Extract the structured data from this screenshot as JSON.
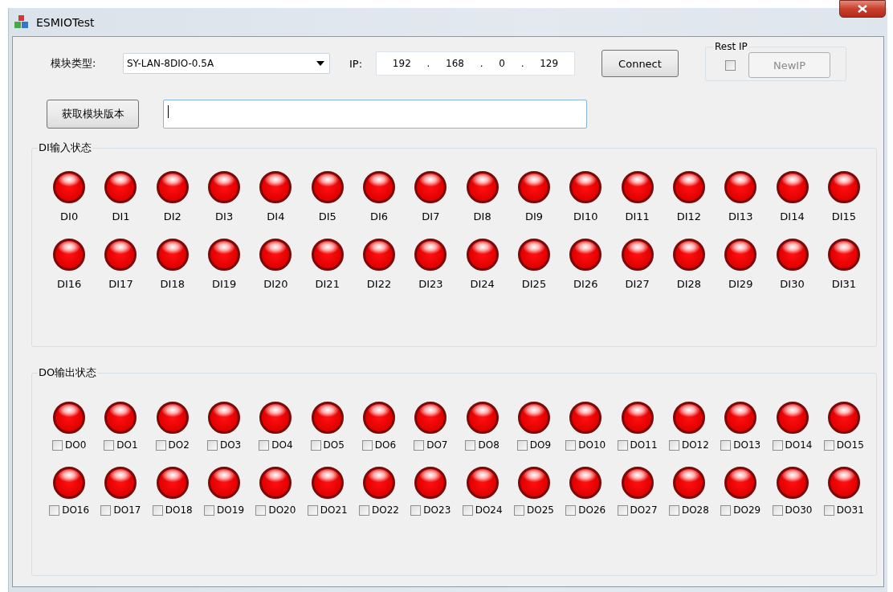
{
  "window": {
    "title": "ESMIOTest"
  },
  "module_type": {
    "label": "模块类型:",
    "value": "SY-LAN-8DIO-0.5A"
  },
  "ip": {
    "label": "IP:",
    "octets": [
      "192",
      "168",
      "0",
      "129"
    ],
    "separator": "."
  },
  "connect_button": "Connect",
  "reset_ip": {
    "title": "Rest IP",
    "checked": false,
    "button": {
      "label": "NewIP",
      "disabled": true
    }
  },
  "version_button": "获取模块版本",
  "di_group": {
    "title": "DI输入状态",
    "inputs": [
      {
        "label": "DI0",
        "on": true
      },
      {
        "label": "DI1",
        "on": true
      },
      {
        "label": "DI2",
        "on": true
      },
      {
        "label": "DI3",
        "on": true
      },
      {
        "label": "DI4",
        "on": true
      },
      {
        "label": "DI5",
        "on": true
      },
      {
        "label": "DI6",
        "on": true
      },
      {
        "label": "DI7",
        "on": true
      },
      {
        "label": "DI8",
        "on": true
      },
      {
        "label": "DI9",
        "on": true
      },
      {
        "label": "DI10",
        "on": true
      },
      {
        "label": "DI11",
        "on": true
      },
      {
        "label": "DI12",
        "on": true
      },
      {
        "label": "DI13",
        "on": true
      },
      {
        "label": "DI14",
        "on": true
      },
      {
        "label": "DI15",
        "on": true
      },
      {
        "label": "DI16",
        "on": true
      },
      {
        "label": "DI17",
        "on": true
      },
      {
        "label": "DI18",
        "on": true
      },
      {
        "label": "DI19",
        "on": true
      },
      {
        "label": "DI20",
        "on": true
      },
      {
        "label": "DI21",
        "on": true
      },
      {
        "label": "DI22",
        "on": true
      },
      {
        "label": "DI23",
        "on": true
      },
      {
        "label": "DI24",
        "on": true
      },
      {
        "label": "DI25",
        "on": true
      },
      {
        "label": "DI26",
        "on": true
      },
      {
        "label": "DI27",
        "on": true
      },
      {
        "label": "DI28",
        "on": true
      },
      {
        "label": "DI29",
        "on": true
      },
      {
        "label": "DI30",
        "on": true
      },
      {
        "label": "DI31",
        "on": true
      }
    ]
  },
  "do_group": {
    "title": "DO输出状态",
    "outputs": [
      {
        "label": "DO0",
        "on": true,
        "checked": false
      },
      {
        "label": "DO1",
        "on": true,
        "checked": false
      },
      {
        "label": "DO2",
        "on": true,
        "checked": false
      },
      {
        "label": "DO3",
        "on": true,
        "checked": false
      },
      {
        "label": "DO4",
        "on": true,
        "checked": false
      },
      {
        "label": "DO5",
        "on": true,
        "checked": false
      },
      {
        "label": "DO6",
        "on": true,
        "checked": false
      },
      {
        "label": "DO7",
        "on": true,
        "checked": false
      },
      {
        "label": "DO8",
        "on": true,
        "checked": false
      },
      {
        "label": "DO9",
        "on": true,
        "checked": false
      },
      {
        "label": "DO10",
        "on": true,
        "checked": false
      },
      {
        "label": "DO11",
        "on": true,
        "checked": false
      },
      {
        "label": "DO12",
        "on": true,
        "checked": false
      },
      {
        "label": "DO13",
        "on": true,
        "checked": false
      },
      {
        "label": "DO14",
        "on": true,
        "checked": false
      },
      {
        "label": "DO15",
        "on": true,
        "checked": false
      },
      {
        "label": "DO16",
        "on": true,
        "checked": false
      },
      {
        "label": "DO17",
        "on": true,
        "checked": false
      },
      {
        "label": "DO18",
        "on": true,
        "checked": false
      },
      {
        "label": "DO19",
        "on": true,
        "checked": false
      },
      {
        "label": "DO20",
        "on": true,
        "checked": false
      },
      {
        "label": "DO21",
        "on": true,
        "checked": false
      },
      {
        "label": "DO22",
        "on": true,
        "checked": false
      },
      {
        "label": "DO23",
        "on": true,
        "checked": false
      },
      {
        "label": "DO24",
        "on": true,
        "checked": false
      },
      {
        "label": "DO25",
        "on": true,
        "checked": false
      },
      {
        "label": "DO26",
        "on": true,
        "checked": false
      },
      {
        "label": "DO27",
        "on": true,
        "checked": false
      },
      {
        "label": "DO28",
        "on": true,
        "checked": false
      },
      {
        "label": "DO29",
        "on": true,
        "checked": false
      },
      {
        "label": "DO30",
        "on": true,
        "checked": false
      },
      {
        "label": "DO31",
        "on": true,
        "checked": false
      }
    ]
  }
}
